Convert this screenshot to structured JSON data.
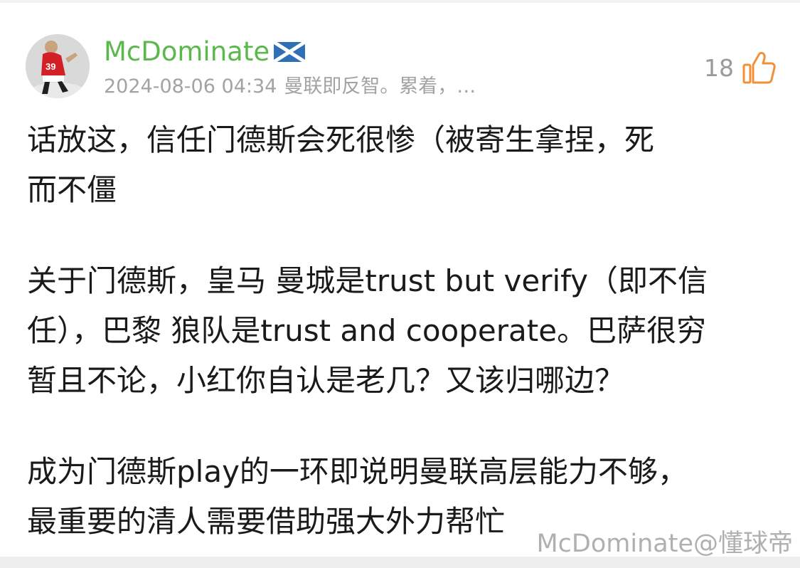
{
  "comment": {
    "username": "McDominate",
    "flag_icon": "scotland-flag-icon",
    "meta": {
      "timestamp": "2024-08-06 04:34",
      "preview": "曼联即反智。累着，…"
    },
    "likes": {
      "count": "18",
      "icon": "thumbs-up-icon",
      "color": "#f0913a"
    },
    "username_color": "#5bb84b",
    "paragraphs": [
      "话放这，信任门德斯会死很惨（被寄生拿捏，死\n而不僵",
      "关于门德斯，皇马 曼城是trust but verify（即不信\n任），巴黎 狼队是trust and cooperate。巴萨很穷\n暂且不论，小红你自认是老几？又该归哪边？",
      "成为门德斯play的一环即说明曼联高层能力不够，\n最重要的清人需要借助强大外力帮忙"
    ]
  },
  "avatar": {
    "jersey_number": "39"
  },
  "watermark": "McDominate@懂球帝"
}
